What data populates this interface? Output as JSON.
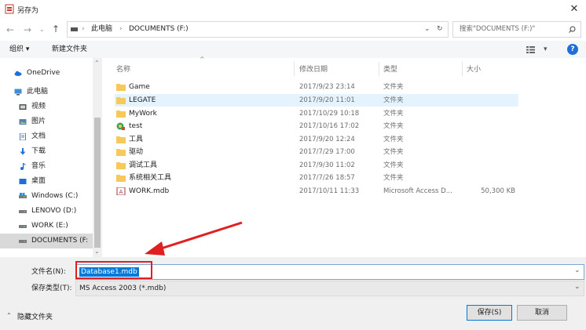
{
  "window": {
    "title": "另存为"
  },
  "nav": {
    "address_parts": [
      "此电脑",
      "DOCUMENTS (F:)"
    ],
    "search_placeholder": "搜索\"DOCUMENTS (F:)\""
  },
  "toolbar": {
    "organize": "组织 ▾",
    "new_folder": "新建文件夹"
  },
  "columns": {
    "name": "名称",
    "modified": "修改日期",
    "type": "类型",
    "size": "大小"
  },
  "sidebar": {
    "items": [
      {
        "label": "OneDrive",
        "icon": "cloud-icon"
      },
      {
        "label": "此电脑",
        "icon": "computer-icon"
      },
      {
        "label": "视频",
        "icon": "video-icon"
      },
      {
        "label": "图片",
        "icon": "picture-icon"
      },
      {
        "label": "文档",
        "icon": "document-icon"
      },
      {
        "label": "下载",
        "icon": "download-icon"
      },
      {
        "label": "音乐",
        "icon": "music-icon"
      },
      {
        "label": "桌面",
        "icon": "desktop-icon"
      },
      {
        "label": "Windows (C:)",
        "icon": "drive-icon"
      },
      {
        "label": "LENOVO (D:)",
        "icon": "drive-icon"
      },
      {
        "label": "WORK (E:)",
        "icon": "drive-icon"
      },
      {
        "label": "DOCUMENTS (F:",
        "icon": "drive-icon"
      }
    ]
  },
  "files": [
    {
      "name": "Game",
      "date": "2017/9/23 23:14",
      "type": "文件夹",
      "size": "",
      "icon": "folder-icon"
    },
    {
      "name": "LEGATE",
      "date": "2017/9/20 11:01",
      "type": "文件夹",
      "size": "",
      "icon": "folder-icon"
    },
    {
      "name": "MyWork",
      "date": "2017/10/29 10:18",
      "type": "文件夹",
      "size": "",
      "icon": "folder-icon"
    },
    {
      "name": "test",
      "date": "2017/10/16 17:02",
      "type": "文件夹",
      "size": "",
      "icon": "special-folder-icon"
    },
    {
      "name": "工具",
      "date": "2017/9/20 12:24",
      "type": "文件夹",
      "size": "",
      "icon": "folder-icon"
    },
    {
      "name": "驱动",
      "date": "2017/7/29 17:00",
      "type": "文件夹",
      "size": "",
      "icon": "folder-icon"
    },
    {
      "name": "调试工具",
      "date": "2017/9/30 11:02",
      "type": "文件夹",
      "size": "",
      "icon": "folder-icon"
    },
    {
      "name": "系统相关工具",
      "date": "2017/7/26 18:57",
      "type": "文件夹",
      "size": "",
      "icon": "folder-icon"
    },
    {
      "name": "WORK.mdb",
      "date": "2017/10/11 11:33",
      "type": "Microsoft Access D...",
      "size": "50,300 KB",
      "icon": "access-file-icon"
    }
  ],
  "form": {
    "filename_label": "文件名(N):",
    "filename_value": "Database1.mdb",
    "filetype_label": "保存类型(T):",
    "filetype_value": "MS Access 2003 (*.mdb)"
  },
  "footer": {
    "hide_folders": "隐藏文件夹",
    "save": "保存(S)",
    "cancel": "取消"
  },
  "colors": {
    "accent": "#0078d7",
    "annotation": "#e02020",
    "folder": "#f7c85a"
  }
}
